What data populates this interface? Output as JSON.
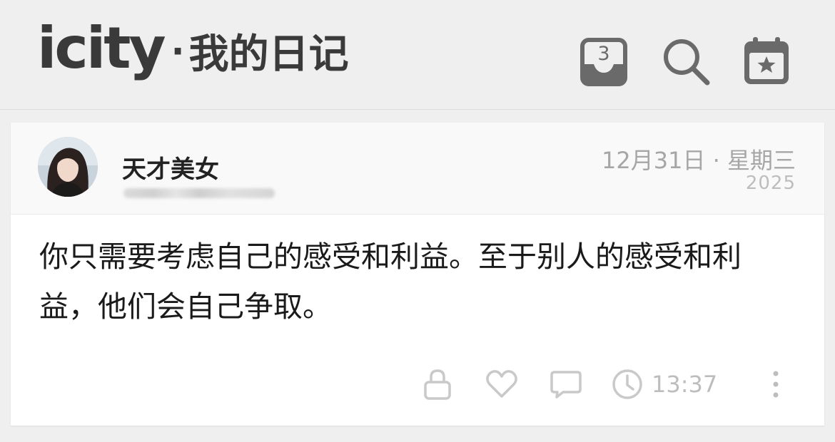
{
  "header": {
    "logo": "icity",
    "separator": "·",
    "subtitle": "我的日记",
    "inbox_count": "3",
    "icons": [
      "inbox-icon",
      "search-icon",
      "calendar-star-icon"
    ]
  },
  "entry": {
    "author": "天才美女",
    "date": "12月31日 · 星期三",
    "year": "2025",
    "text": "你只需要考虑自己的感受和利益。至于别人的感受和利益，他们会自己争取。",
    "time": "13:37",
    "footer_icons": [
      "lock-icon",
      "heart-icon",
      "comment-icon",
      "clock-icon",
      "more-icon"
    ]
  },
  "colors": {
    "background": "#efefef",
    "card": "#ffffff",
    "header_text": "#3a3a3a",
    "muted": "#bdbdbd"
  }
}
